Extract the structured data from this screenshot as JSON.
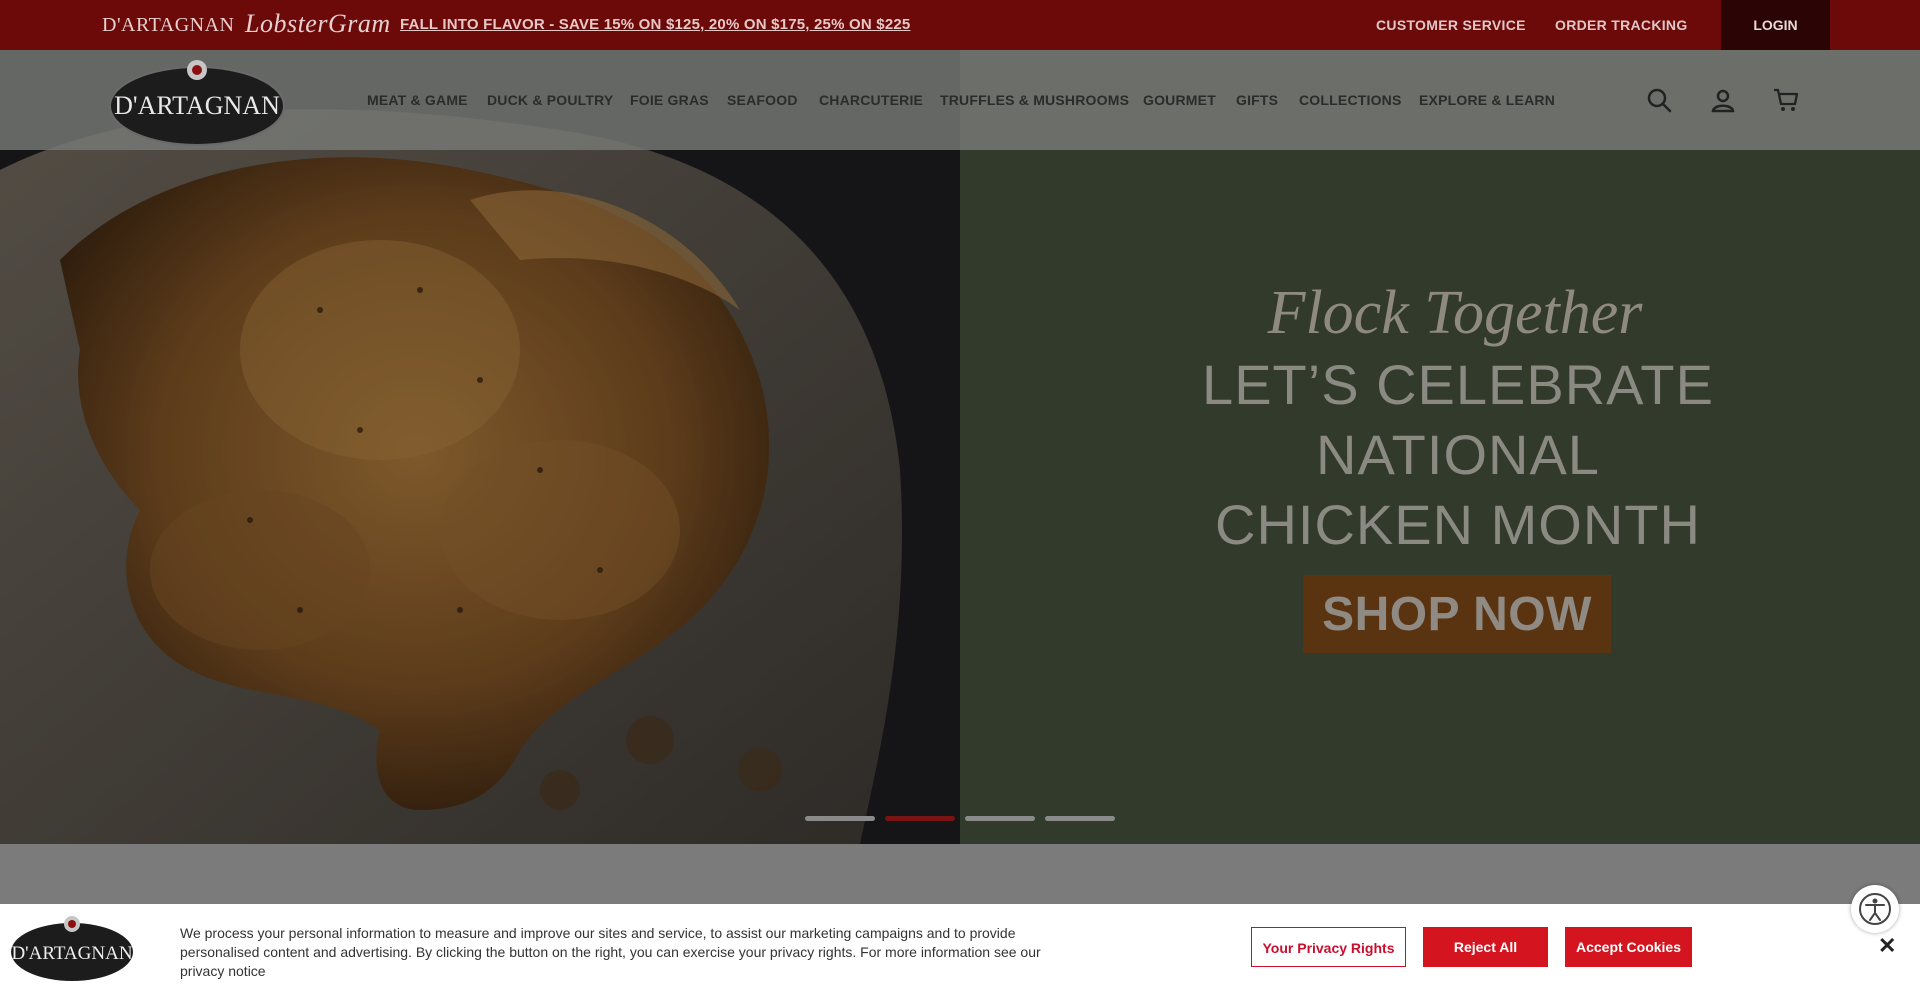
{
  "topbar": {
    "brand_dartagnan": "D'ARTAGNAN",
    "brand_lobster": "LobsterGram",
    "promo": "FALL INTO FLAVOR - SAVE 15% ON $125, 20% ON $175, 25% ON $225",
    "customer_service": "CUSTOMER SERVICE",
    "order_tracking": "ORDER TRACKING",
    "login": "LOGIN",
    "bg_color": "#6c0a0a"
  },
  "header": {
    "logo_text": "D'ARTAGNAN",
    "nav": [
      "MEAT & GAME",
      "DUCK & POULTRY",
      "FOIE GRAS",
      "SEAFOOD",
      "CHARCUTERIE",
      "TRUFFLES & MUSHROOMS",
      "GOURMET",
      "GIFTS",
      "COLLECTIONS",
      "EXPLORE & LEARN"
    ],
    "icons": [
      "search-icon",
      "account-icon",
      "cart-icon"
    ]
  },
  "hero": {
    "script_title": "Flock Together",
    "headline_line1": "LET’S CELEBRATE NATIONAL",
    "headline_line2": "CHICKEN MONTH",
    "cta": "SHOP NOW",
    "slides": 4,
    "active_slide": 2,
    "accent_color": "#7a1414"
  },
  "cookie": {
    "logo_text": "D'ARTAGNAN",
    "text": "We process your personal information to measure and improve our sites and service, to assist our marketing campaigns and to provide personalised content and advertising. By clicking the button on the right, you can exercise your privacy rights. For more information see our privacy notice",
    "privacy_rights": "Your Privacy Rights",
    "reject": "Reject All",
    "accept": "Accept Cookies",
    "close": "✕",
    "button_color": "#d4141e"
  }
}
